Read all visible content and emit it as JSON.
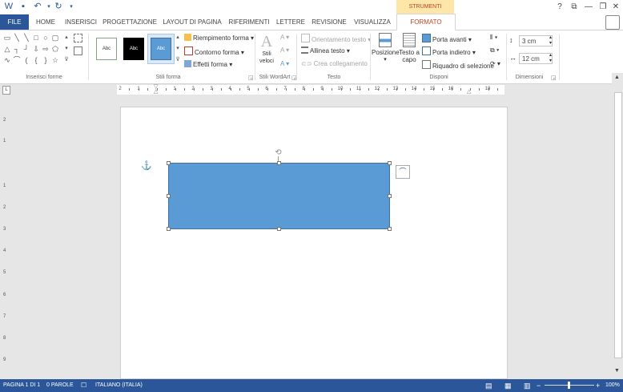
{
  "titlebar": {
    "contextual_title": "STRUMENTI DISEGNO",
    "help": "?",
    "restore": "⧉",
    "minimize": "—",
    "maximize": "❐",
    "close": "✕"
  },
  "tabs": {
    "file": "FILE",
    "home": "HOME",
    "insert": "INSERISCI",
    "design": "PROGETTAZIONE",
    "layout": "LAYOUT DI PAGINA",
    "references": "RIFERIMENTI",
    "mailings": "LETTERE",
    "review": "REVISIONE",
    "view": "VISUALIZZA",
    "format": "FORMATO"
  },
  "ribbon": {
    "groups": {
      "insert_shapes": "Inserisci forme",
      "shape_styles": "Stili forma",
      "wordart": "Stili WordArt",
      "text": "Testo",
      "arrange": "Disponi",
      "size": "Dimensioni"
    },
    "style_preview": "Abc",
    "shape_fill": "Riempimento forma",
    "shape_outline": "Contorno forma",
    "shape_effects": "Effetti forma",
    "quick_styles": "Stili veloci",
    "text_direction": "Orientamento testo",
    "align_text": "Allinea testo",
    "create_link": "Crea collegamento",
    "position": "Posizione",
    "wrap_text_1": "Testo a",
    "wrap_text_2": "capo",
    "bring_forward": "Porta avanti",
    "send_backward": "Porta indietro",
    "selection_pane": "Riquadro di selezione",
    "height": "3 cm",
    "width": "12 cm"
  },
  "ruler": {
    "labels": [
      "2",
      "1",
      "1",
      "2",
      "3",
      "4",
      "5",
      "6",
      "7",
      "8",
      "9",
      "10",
      "11",
      "12",
      "13",
      "14",
      "15",
      "16",
      "18"
    ]
  },
  "vruler": {
    "labels": [
      "2",
      "1",
      "1",
      "2",
      "3",
      "4",
      "5",
      "6",
      "7",
      "8",
      "9"
    ]
  },
  "colors": {
    "accent": "#2b579a",
    "shape_fill": "#5b9bd5",
    "contextual_tab": "#b7472a"
  },
  "status": {
    "page": "PAGINA 1 DI 1",
    "words": "0 PAROLE",
    "language": "ITALIANO (ITALIA)",
    "zoom": "100%",
    "zoom_minus": "−",
    "zoom_plus": "+"
  }
}
